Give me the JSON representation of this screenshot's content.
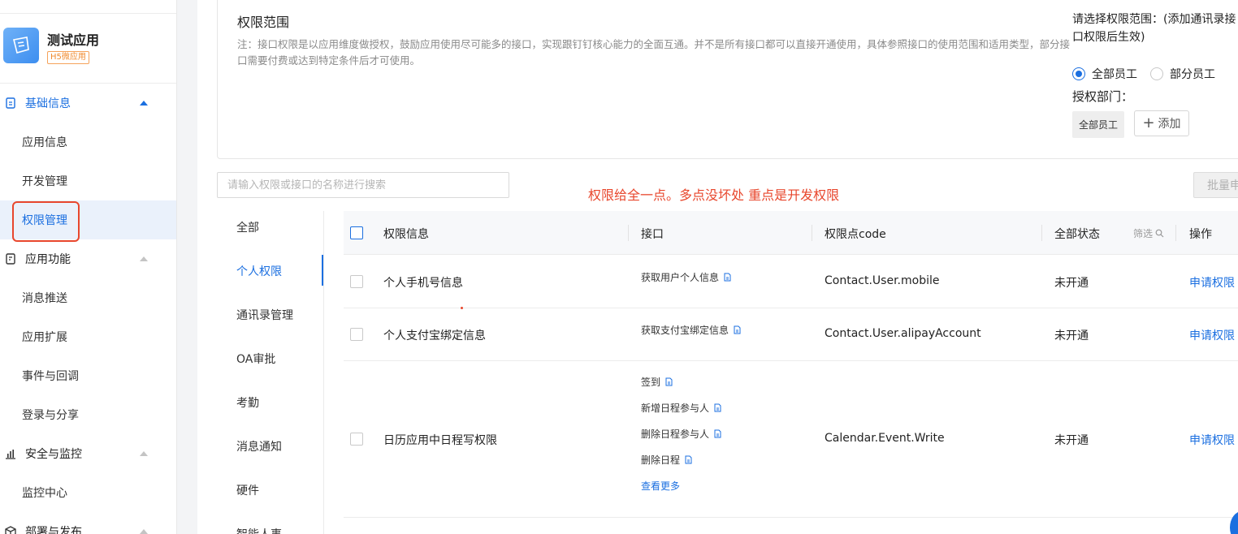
{
  "app": {
    "title": "测试应用",
    "badge": "H5微应用"
  },
  "sidebar": {
    "groups": [
      {
        "label": "基础信息",
        "icon": "doc-info-icon"
      },
      {
        "label": "应用功能",
        "icon": "app-function-icon"
      },
      {
        "label": "安全与监控",
        "icon": "bar-chart-icon"
      },
      {
        "label": "部署与发布",
        "icon": "cube-icon"
      }
    ],
    "items": {
      "app_info": "应用信息",
      "dev_manage": "开发管理",
      "perm_manage": "权限管理",
      "msg_push": "消息推送",
      "app_ext": "应用扩展",
      "event_callback": "事件与回调",
      "login_share": "登录与分享",
      "monitor_center": "监控中心"
    }
  },
  "scope": {
    "title": "权限范围",
    "note": "注：接口权限是以应用维度做授权，鼓励应用使用尽可能多的接口，实现跟钉钉核心能力的全面互通。并不是所有接口都可以直接开通使用，具体参照接口的使用范围和适用类型，部分接口需要付费或达到特定条件后才可使用。",
    "select_label": "请选择权限范围：(添加通讯录接口权限后生效)",
    "radio_all": "全部员工",
    "radio_partial": "部分员工",
    "selected": "全部员工",
    "auth_dept_label": "授权部门：",
    "dept_tag": "全部员工",
    "add_label": "添加"
  },
  "search": {
    "placeholder": "请输入权限或接口的名称进行搜索"
  },
  "annotation": "权限给全一点。多点没坏处 重点是开发权限",
  "batch_button": "批量申",
  "categories": [
    "全部",
    "个人权限",
    "通讯录管理",
    "OA审批",
    "考勤",
    "消息通知",
    "硬件",
    "智能人事"
  ],
  "active_category": "个人权限",
  "table": {
    "headers": {
      "info": "权限信息",
      "api": "接口",
      "code": "权限点code",
      "status": "全部状态",
      "filter": "筛选",
      "action": "操作"
    },
    "rows": [
      {
        "info": "个人手机号信息",
        "apis": [
          "获取用户个人信息"
        ],
        "code": "Contact.User.mobile",
        "status": "未开通",
        "action": "申请权限"
      },
      {
        "info": "个人支付宝绑定信息",
        "apis": [
          "获取支付宝绑定信息"
        ],
        "code": "Contact.User.alipayAccount",
        "status": "未开通",
        "action": "申请权限"
      },
      {
        "info": "日历应用中日程写权限",
        "apis": [
          "签到",
          "新增日程参与人",
          "删除日程参与人",
          "删除日程"
        ],
        "more": "查看更多",
        "code": "Calendar.Event.Write",
        "status": "未开通",
        "action": "申请权限"
      }
    ]
  },
  "colors": {
    "accent": "#1b6fe0",
    "annotation": "#e8472d",
    "badge": "#f08a2e"
  }
}
